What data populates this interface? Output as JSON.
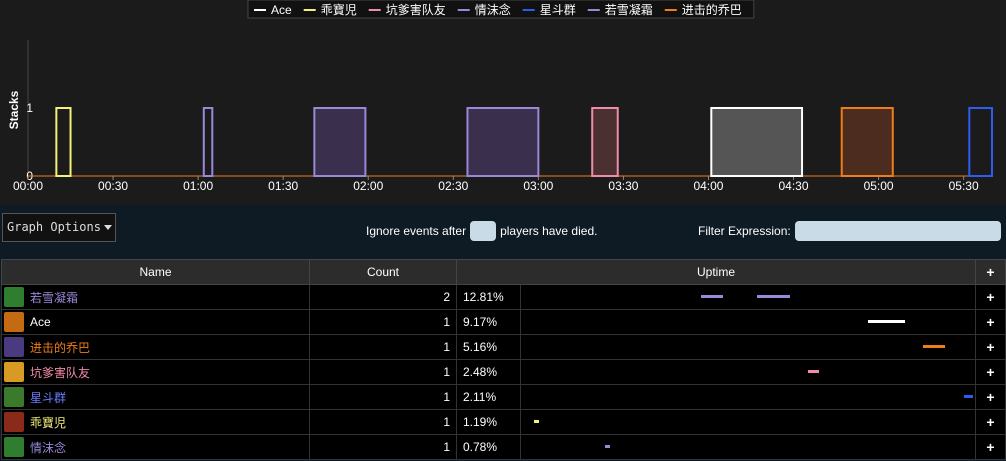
{
  "chart": {
    "ylabel": "Stacks",
    "y_ticks": [
      "0",
      "1"
    ],
    "x_ticks": [
      "00:00",
      "00:30",
      "01:00",
      "01:30",
      "02:00",
      "02:30",
      "03:00",
      "03:30",
      "04:00",
      "04:30",
      "05:00",
      "05:30"
    ],
    "legend": [
      {
        "name": "Ace",
        "color": "#ffffff"
      },
      {
        "name": "乖寶児",
        "color": "#f5f07a"
      },
      {
        "name": "坑爹害队友",
        "color": "#f08ca8"
      },
      {
        "name": "情沫念",
        "color": "#9a88d8"
      },
      {
        "name": "星斗群",
        "color": "#2f5cf0"
      },
      {
        "name": "若雪凝霜",
        "color": "#9a88d8"
      },
      {
        "name": "进击的乔巴",
        "color": "#f07d1c"
      }
    ]
  },
  "chart_data": {
    "type": "area",
    "ylabel": "Stacks",
    "ylim": [
      0,
      1
    ],
    "x_unit": "mm:ss",
    "xlim": [
      "00:00",
      "05:40"
    ],
    "series": [
      {
        "name": "乖寶児",
        "color": "#f5f07a",
        "fill": "#1b1b1b",
        "intervals": [
          [
            "00:10",
            "00:15"
          ]
        ]
      },
      {
        "name": "情沫念",
        "color": "#9a88d8",
        "fill": "#1b1b1b",
        "intervals": [
          [
            "01:02",
            "01:05"
          ]
        ]
      },
      {
        "name": "若雪凝霜",
        "color": "#9a88d8",
        "fill": "#3a2f4c",
        "intervals": [
          [
            "01:41",
            "01:59"
          ],
          [
            "02:35",
            "03:00"
          ]
        ]
      },
      {
        "name": "坑爹害队友",
        "color": "#f08ca8",
        "fill": "#4a3030",
        "intervals": [
          [
            "03:19",
            "03:28"
          ]
        ]
      },
      {
        "name": "Ace",
        "color": "#ffffff",
        "fill": "#555555",
        "intervals": [
          [
            "04:01",
            "04:33"
          ]
        ]
      },
      {
        "name": "进击的乔巴",
        "color": "#f07d1c",
        "fill": "#4b2c1e",
        "intervals": [
          [
            "04:47",
            "05:05"
          ]
        ]
      },
      {
        "name": "星斗群",
        "color": "#2f5cf0",
        "fill": "#1b1b1b",
        "intervals": [
          [
            "05:32",
            "05:40"
          ]
        ]
      }
    ]
  },
  "controls": {
    "graph_options": "Graph Options",
    "ignore_before": "Ignore events after",
    "ignore_after": "players have died.",
    "ignore_value": "",
    "filter_label": "Filter Expression:",
    "filter_value": ""
  },
  "table": {
    "headers": {
      "name": "Name",
      "count": "Count",
      "uptime": "Uptime",
      "plus": "+"
    },
    "rows": [
      {
        "name": "若雪凝霜",
        "color": "#9a88d8",
        "avatar": "#2f7d2f",
        "count": "2",
        "pct": "12.81%",
        "plus": "+",
        "segs": [
          {
            "s": 0.397,
            "e": 0.445,
            "c": "#9a88d8"
          },
          {
            "s": 0.519,
            "e": 0.593,
            "c": "#9a88d8"
          }
        ]
      },
      {
        "name": "Ace",
        "color": "#ffffff",
        "avatar": "#c46a12",
        "count": "1",
        "pct": "9.17%",
        "plus": "+",
        "segs": [
          {
            "s": 0.765,
            "e": 0.846,
            "c": "#ffffff"
          }
        ]
      },
      {
        "name": "进击的乔巴",
        "color": "#f07d1c",
        "avatar": "#4a3a80",
        "count": "1",
        "pct": "5.16%",
        "plus": "+",
        "segs": [
          {
            "s": 0.885,
            "e": 0.935,
            "c": "#f07d1c"
          }
        ]
      },
      {
        "name": "坑爹害队友",
        "color": "#f08ca8",
        "avatar": "#d89a22",
        "count": "1",
        "pct": "2.48%",
        "plus": "+",
        "segs": [
          {
            "s": 0.633,
            "e": 0.656,
            "c": "#f08ca8"
          }
        ]
      },
      {
        "name": "星斗群",
        "color": "#6a7cff",
        "avatar": "#3a7a2a",
        "count": "1",
        "pct": "2.11%",
        "plus": "+",
        "segs": [
          {
            "s": 0.975,
            "e": 0.995,
            "c": "#2f5cf0"
          }
        ]
      },
      {
        "name": "乖寶児",
        "color": "#f5f07a",
        "avatar": "#8a2a1a",
        "count": "1",
        "pct": "1.19%",
        "plus": "+",
        "segs": [
          {
            "s": 0.028,
            "e": 0.04,
            "c": "#f5f07a"
          }
        ]
      },
      {
        "name": "情沫念",
        "color": "#9a88d8",
        "avatar": "#2f7d2f",
        "count": "1",
        "pct": "0.78%",
        "plus": "+",
        "segs": [
          {
            "s": 0.185,
            "e": 0.195,
            "c": "#9a88d8"
          }
        ]
      }
    ]
  }
}
